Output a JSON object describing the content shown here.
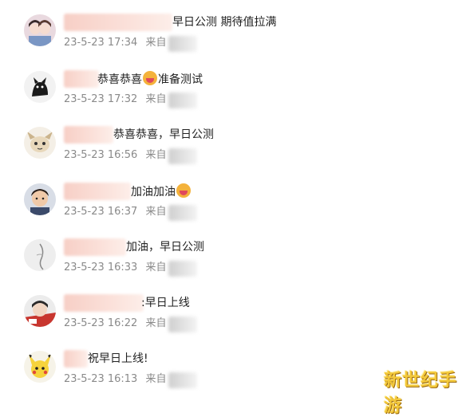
{
  "comments": [
    {
      "text": "早日公测 期待值拉满",
      "date": "23-5-23 17:34",
      "source_prefix": "来自",
      "avatar": "couple-avatar-icon"
    },
    {
      "text": "恭喜恭喜",
      "text_after_emoji": "准备测试",
      "date": "23-5-23 17:32",
      "source_prefix": "来自",
      "avatar": "black-cat-avatar-icon"
    },
    {
      "text": "恭喜恭喜，早日公测",
      "date": "23-5-23 16:56",
      "source_prefix": "来自",
      "avatar": "cartoon-avatar-icon"
    },
    {
      "text": "加油加油",
      "date": "23-5-23 16:37",
      "source_prefix": "来自",
      "avatar": "man-avatar-icon"
    },
    {
      "text": "加油，早日公测",
      "date": "23-5-23 16:33",
      "source_prefix": "来自",
      "avatar": "sketch-avatar-icon"
    },
    {
      "text": ":早日上线",
      "date": "23-5-23 16:22",
      "source_prefix": "来自",
      "avatar": "anime-avatar-icon"
    },
    {
      "text": "祝早日上线!",
      "date": "23-5-23 16:13",
      "source_prefix": "来自",
      "avatar": "pikachu-avatar-icon"
    }
  ],
  "watermark": "新世纪手游"
}
